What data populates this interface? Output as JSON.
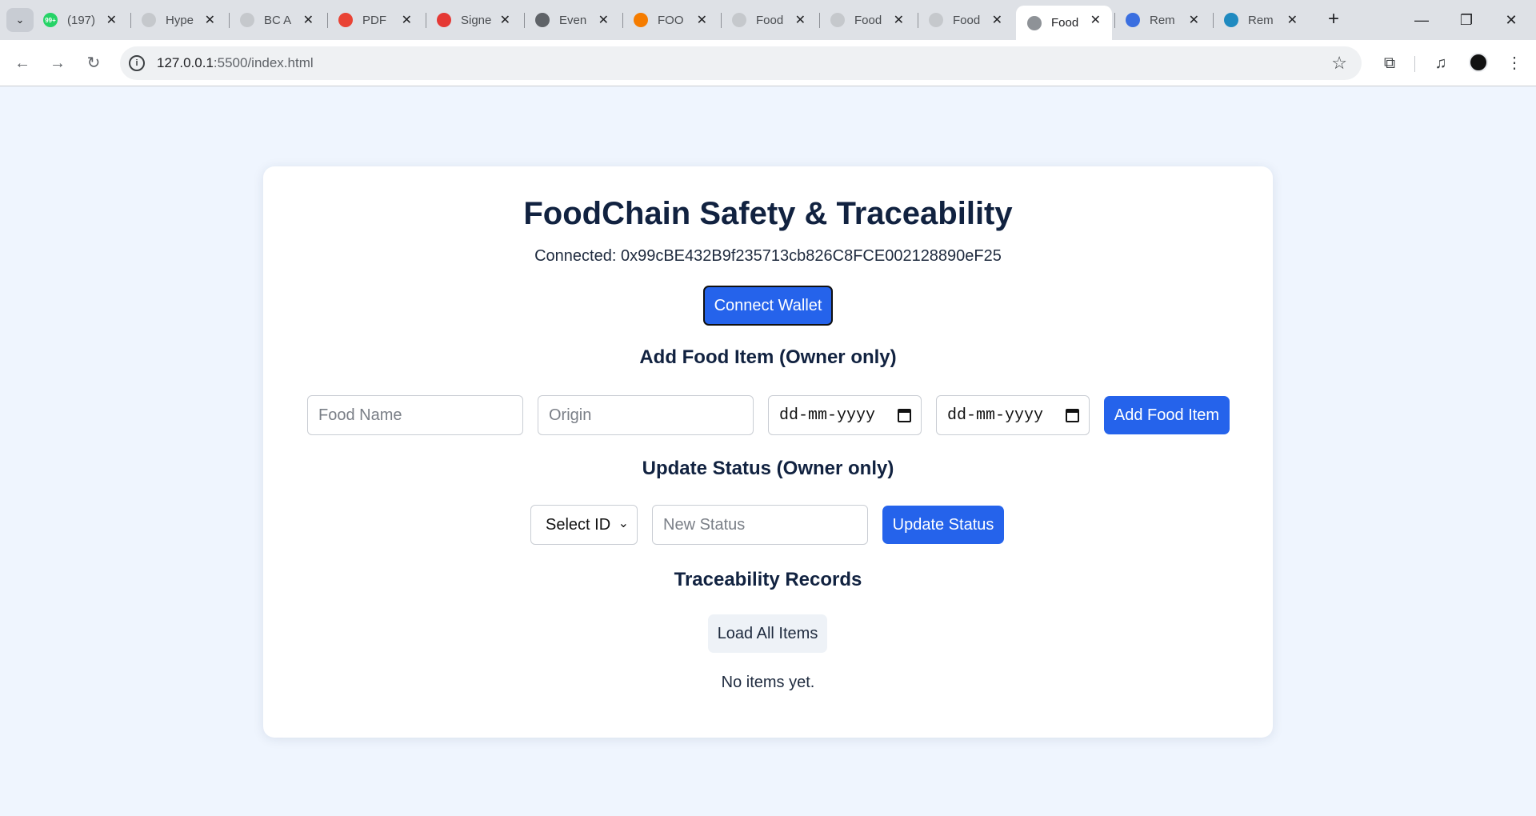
{
  "browser": {
    "tabs": [
      {
        "title": "(197)",
        "favicon": "whatsapp-icon",
        "color": "#25d366",
        "badge": "99+"
      },
      {
        "title": "Hype",
        "favicon": "globe-icon",
        "color": "#c5c8cc"
      },
      {
        "title": "BC A",
        "favicon": "globe-icon",
        "color": "#c5c8cc"
      },
      {
        "title": "PDF",
        "favicon": "pdf-icon",
        "color": "#e94335"
      },
      {
        "title": "Signe",
        "favicon": "w-icon",
        "color": "#e53935"
      },
      {
        "title": "Even",
        "favicon": "openai-icon",
        "color": "#5f6368"
      },
      {
        "title": "FOO",
        "favicon": "flame-icon",
        "color": "#f57c00"
      },
      {
        "title": "Food",
        "favicon": "globe-icon",
        "color": "#c5c8cc"
      },
      {
        "title": "Food",
        "favicon": "globe-icon",
        "color": "#c5c8cc"
      },
      {
        "title": "Food",
        "favicon": "globe-icon",
        "color": "#c5c8cc"
      },
      {
        "title": "Food",
        "favicon": "globe-icon",
        "color": "#8e9297",
        "active": true
      },
      {
        "title": "Rem",
        "favicon": "remix-icon",
        "color": "#3b6fe0"
      },
      {
        "title": "Rem",
        "favicon": "remix-icon",
        "color": "#1f8ac0"
      }
    ],
    "url_host": "127.0.0.1",
    "url_path": ":5500/index.html"
  },
  "app": {
    "title": "FoodChain Safety & Traceability",
    "connected_text": "Connected: 0x99cBE432B9f235713cb826C8FCE002128890eF25",
    "connect_button": "Connect Wallet",
    "add_section": {
      "heading": "Add Food Item (Owner only)",
      "food_name_placeholder": "Food Name",
      "origin_placeholder": "Origin",
      "date_placeholder": "dd-mm-yyyy",
      "submit": "Add Food Item"
    },
    "update_section": {
      "heading": "Update Status (Owner only)",
      "select_value": "Select ID",
      "status_placeholder": "New Status",
      "submit": "Update Status"
    },
    "records_section": {
      "heading": "Traceability Records",
      "load_button": "Load All Items",
      "empty_text": "No items yet."
    },
    "colors": {
      "accent": "#2563eb",
      "heading": "#112240",
      "background": "#eff5fe"
    }
  }
}
